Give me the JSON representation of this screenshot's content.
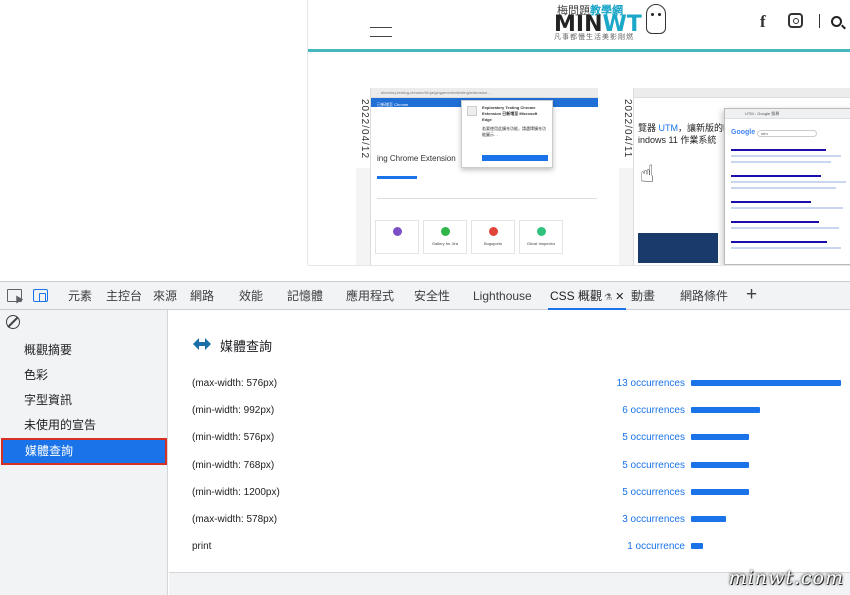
{
  "site": {
    "logo_top": "梅問題",
    "logo_top_highlight": "教學網",
    "logo_main_a": "MIN",
    "logo_main_b": "WT",
    "logo_sub": "凡事都慢生活美影剛燃",
    "cards": [
      {
        "date": "2022/04/12",
        "url_text": "…directory.testing-chrome/hl=ja/gingamemix/testing/extension…",
        "tab_label": "已新增至 Chrome",
        "popup_title": "Exploratory Testing Chrome Extension 已新增至 Microsoft Edge",
        "popup_body": "若要使用此擴充功能，請選擇擴充功能圖示…",
        "headline": "ing Chrome Extension",
        "tiles": [
          "Gallery for Jira",
          "Bugsports",
          "Ghost Inspector"
        ]
      },
      {
        "date": "2022/04/11",
        "headline_a": "覽器 ",
        "headline_highlight": "UTM",
        "headline_b": "，讓新版的MAC",
        "headline_line2": "indows 11 作業系統",
        "google_title": "UTM - Google 搜尋",
        "google_query": "utm"
      }
    ]
  },
  "devtools": {
    "tabs": [
      {
        "label": "元素"
      },
      {
        "label": "主控台"
      },
      {
        "label": "來源"
      },
      {
        "label": "網路"
      },
      {
        "label": "效能"
      },
      {
        "label": "記憶體"
      },
      {
        "label": "應用程式"
      },
      {
        "label": "安全性"
      },
      {
        "label": "Lighthouse"
      },
      {
        "label": "CSS 概觀"
      },
      {
        "label": "動畫"
      },
      {
        "label": "網路條件"
      }
    ],
    "active_tab": "CSS 概觀",
    "sidebar": [
      {
        "label": "概觀摘要"
      },
      {
        "label": "色彩"
      },
      {
        "label": "字型資訊"
      },
      {
        "label": "未使用的宣告"
      },
      {
        "label": "媒體查詢"
      }
    ],
    "active_sidebar": "媒體查詢",
    "section_title": "媒體查詢",
    "media_queries": [
      {
        "query": "(max-width: 576px)",
        "count": "13 occurrences",
        "occurrences": 13
      },
      {
        "query": "(min-width: 992px)",
        "count": "6 occurrences",
        "occurrences": 6
      },
      {
        "query": "(min-width: 576px)",
        "count": "5 occurrences",
        "occurrences": 5
      },
      {
        "query": "(min-width: 768px)",
        "count": "5 occurrences",
        "occurrences": 5
      },
      {
        "query": "(min-width: 1200px)",
        "count": "5 occurrences",
        "occurrences": 5
      },
      {
        "query": "(max-width: 578px)",
        "count": "3 occurrences",
        "occurrences": 3
      },
      {
        "query": "print",
        "count": "1 occurrence",
        "occurrences": 1
      }
    ]
  },
  "colors": {
    "accent": "#1a73e8",
    "site_accent": "#45b8bf",
    "highlight_border": "#d93025"
  },
  "watermark": "minwt.com"
}
